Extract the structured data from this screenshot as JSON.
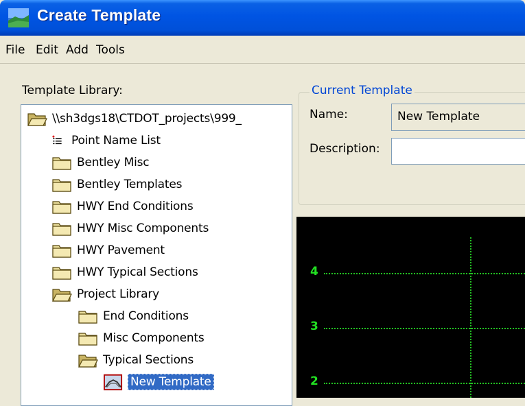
{
  "window": {
    "title": "Create Template"
  },
  "menu": [
    "File",
    "Edit",
    "Add",
    "Tools"
  ],
  "library": {
    "label": "Template Library:",
    "tree": [
      {
        "label": "\\\\sh3dgs18\\CTDOT_projects\\999_",
        "icon": "open-folder-icon"
      },
      {
        "label": "Point Name List",
        "icon": "point-list-icon"
      },
      {
        "label": "Bentley Misc",
        "icon": "folder-icon"
      },
      {
        "label": "Bentley Templates",
        "icon": "folder-icon"
      },
      {
        "label": "HWY End Conditions",
        "icon": "folder-icon"
      },
      {
        "label": "HWY Misc Components",
        "icon": "folder-icon"
      },
      {
        "label": "HWY Pavement",
        "icon": "folder-icon"
      },
      {
        "label": "HWY Typical Sections",
        "icon": "folder-icon"
      },
      {
        "label": "Project Library",
        "icon": "open-folder-icon"
      },
      {
        "label": "End Conditions",
        "icon": "folder-icon"
      },
      {
        "label": "Misc Components",
        "icon": "folder-icon"
      },
      {
        "label": "Typical Sections",
        "icon": "open-folder-icon"
      },
      {
        "label": "New Template",
        "icon": "template-icon",
        "selected": true
      }
    ]
  },
  "current_template": {
    "legend": "Current Template",
    "name_label": "Name:",
    "name_value": "New Template",
    "description_label": "Description:",
    "description_value": ""
  },
  "canvas": {
    "background": "#000000",
    "grid_color": "#22e022",
    "y_labels": [
      "4",
      "3",
      "2"
    ]
  },
  "colors": {
    "title_bar": "#0054e3",
    "selection": "#316ac5",
    "legend": "#0046d5"
  }
}
